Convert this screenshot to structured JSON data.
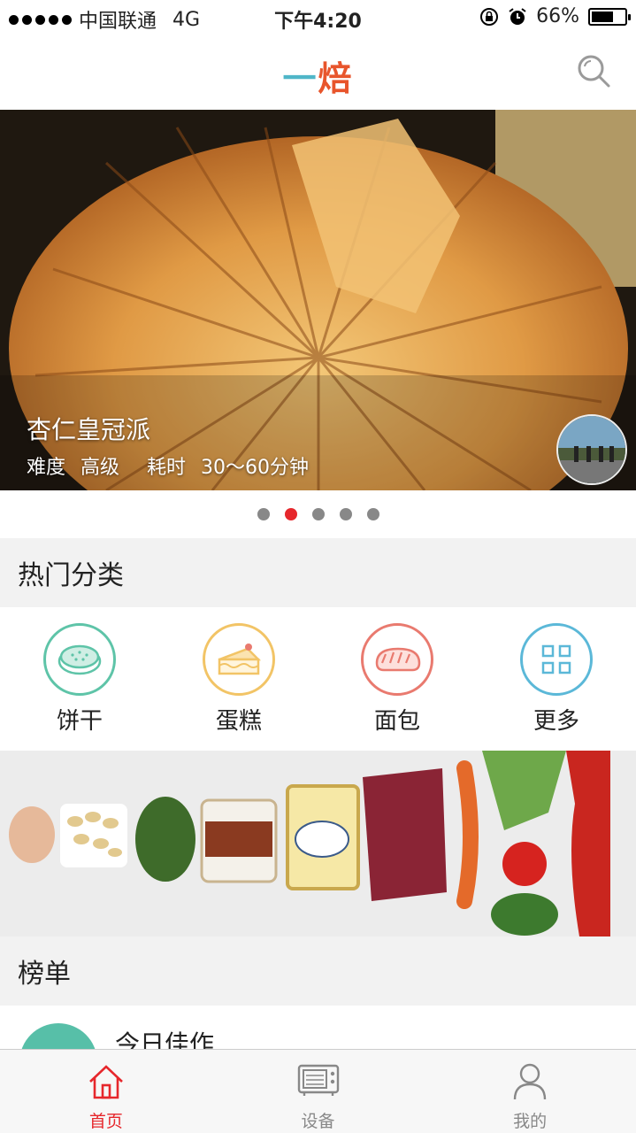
{
  "status_bar": {
    "carrier": "中国联通",
    "network": "4G",
    "time": "下午4:20",
    "battery": "66%",
    "battery_level": 0.66
  },
  "app": {
    "logo_text": "一焙"
  },
  "hero": {
    "title": "杏仁皇冠派",
    "difficulty_label": "难度",
    "difficulty": "高级",
    "time_label": "耗时",
    "time": "30～60分钟",
    "active_page": 1,
    "pages": 5
  },
  "hot_categories": {
    "title": "热门分类",
    "items": [
      {
        "label": "饼干",
        "color": "#5ec4a8",
        "icon": "biscuit-icon"
      },
      {
        "label": "蛋糕",
        "color": "#f2c466",
        "icon": "cake-icon"
      },
      {
        "label": "面包",
        "color": "#e97a6f",
        "icon": "bread-icon"
      },
      {
        "label": "更多",
        "color": "#5bb8d8",
        "icon": "grid-icon"
      }
    ]
  },
  "ranking": {
    "title": "榜单",
    "first_item": "今日佳作"
  },
  "tabbar": {
    "items": [
      {
        "label": "首页",
        "icon": "home-icon",
        "active": true
      },
      {
        "label": "设备",
        "icon": "oven-icon",
        "active": false
      },
      {
        "label": "我的",
        "icon": "user-icon",
        "active": false
      }
    ]
  },
  "colors": {
    "accent": "#e6272c",
    "logo": "#e8552c"
  }
}
